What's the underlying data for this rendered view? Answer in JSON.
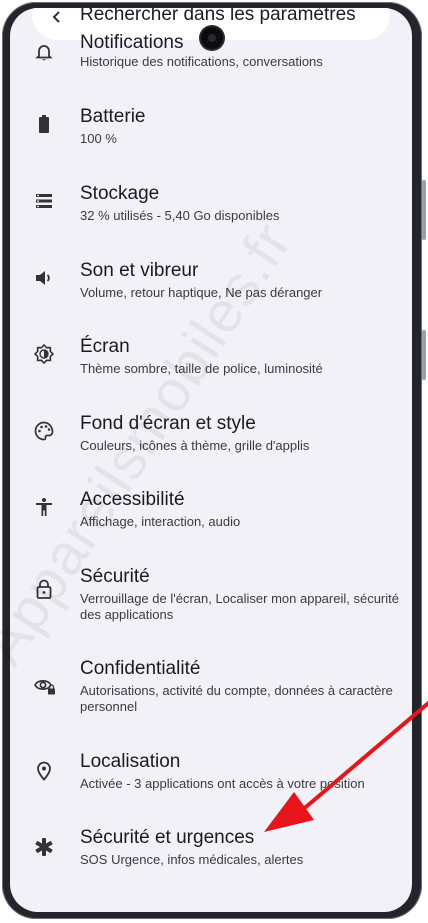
{
  "search": {
    "text": "Rechercher dans les paramètres"
  },
  "settings_items": [
    {
      "icon": "bell-icon",
      "title": "Notifications",
      "subtitle": "Historique des notifications, conversations"
    },
    {
      "icon": "battery-icon",
      "title": "Batterie",
      "subtitle": "100 %"
    },
    {
      "icon": "storage-icon",
      "title": "Stockage",
      "subtitle": "32 % utilisés - 5,40 Go disponibles"
    },
    {
      "icon": "speaker-icon",
      "title": "Son et vibreur",
      "subtitle": "Volume, retour haptique, Ne pas déranger"
    },
    {
      "icon": "brightness-icon",
      "title": "Écran",
      "subtitle": "Thème sombre, taille de police, luminosité"
    },
    {
      "icon": "palette-icon",
      "title": "Fond d'écran et style",
      "subtitle": "Couleurs, icônes à thème, grille d'applis"
    },
    {
      "icon": "accessibility-icon",
      "title": "Accessibilité",
      "subtitle": "Affichage, interaction, audio"
    },
    {
      "icon": "lock-icon",
      "title": "Sécurité",
      "subtitle": "Verrouillage de l'écran, Localiser mon appareil, sécurité des applications"
    },
    {
      "icon": "privacy-eye-icon",
      "title": "Confidentialité",
      "subtitle": "Autorisations, activité du compte, données à caractère personnel"
    },
    {
      "icon": "location-pin-icon",
      "title": "Localisation",
      "subtitle": "Activée - 3 applications ont accès à votre position"
    },
    {
      "icon": "asterisk-emergency-icon",
      "title": "Sécurité et urgences",
      "subtitle": "SOS Urgence, infos médicales, alertes"
    }
  ],
  "watermark": "Appareilsmobiles.fr",
  "colors": {
    "screen_background": "#f1f1f7",
    "frame": "#23252b",
    "annotation_arrow": "#e8141b",
    "text_primary": "#1b1b1f",
    "text_secondary": "#3a3a40"
  }
}
